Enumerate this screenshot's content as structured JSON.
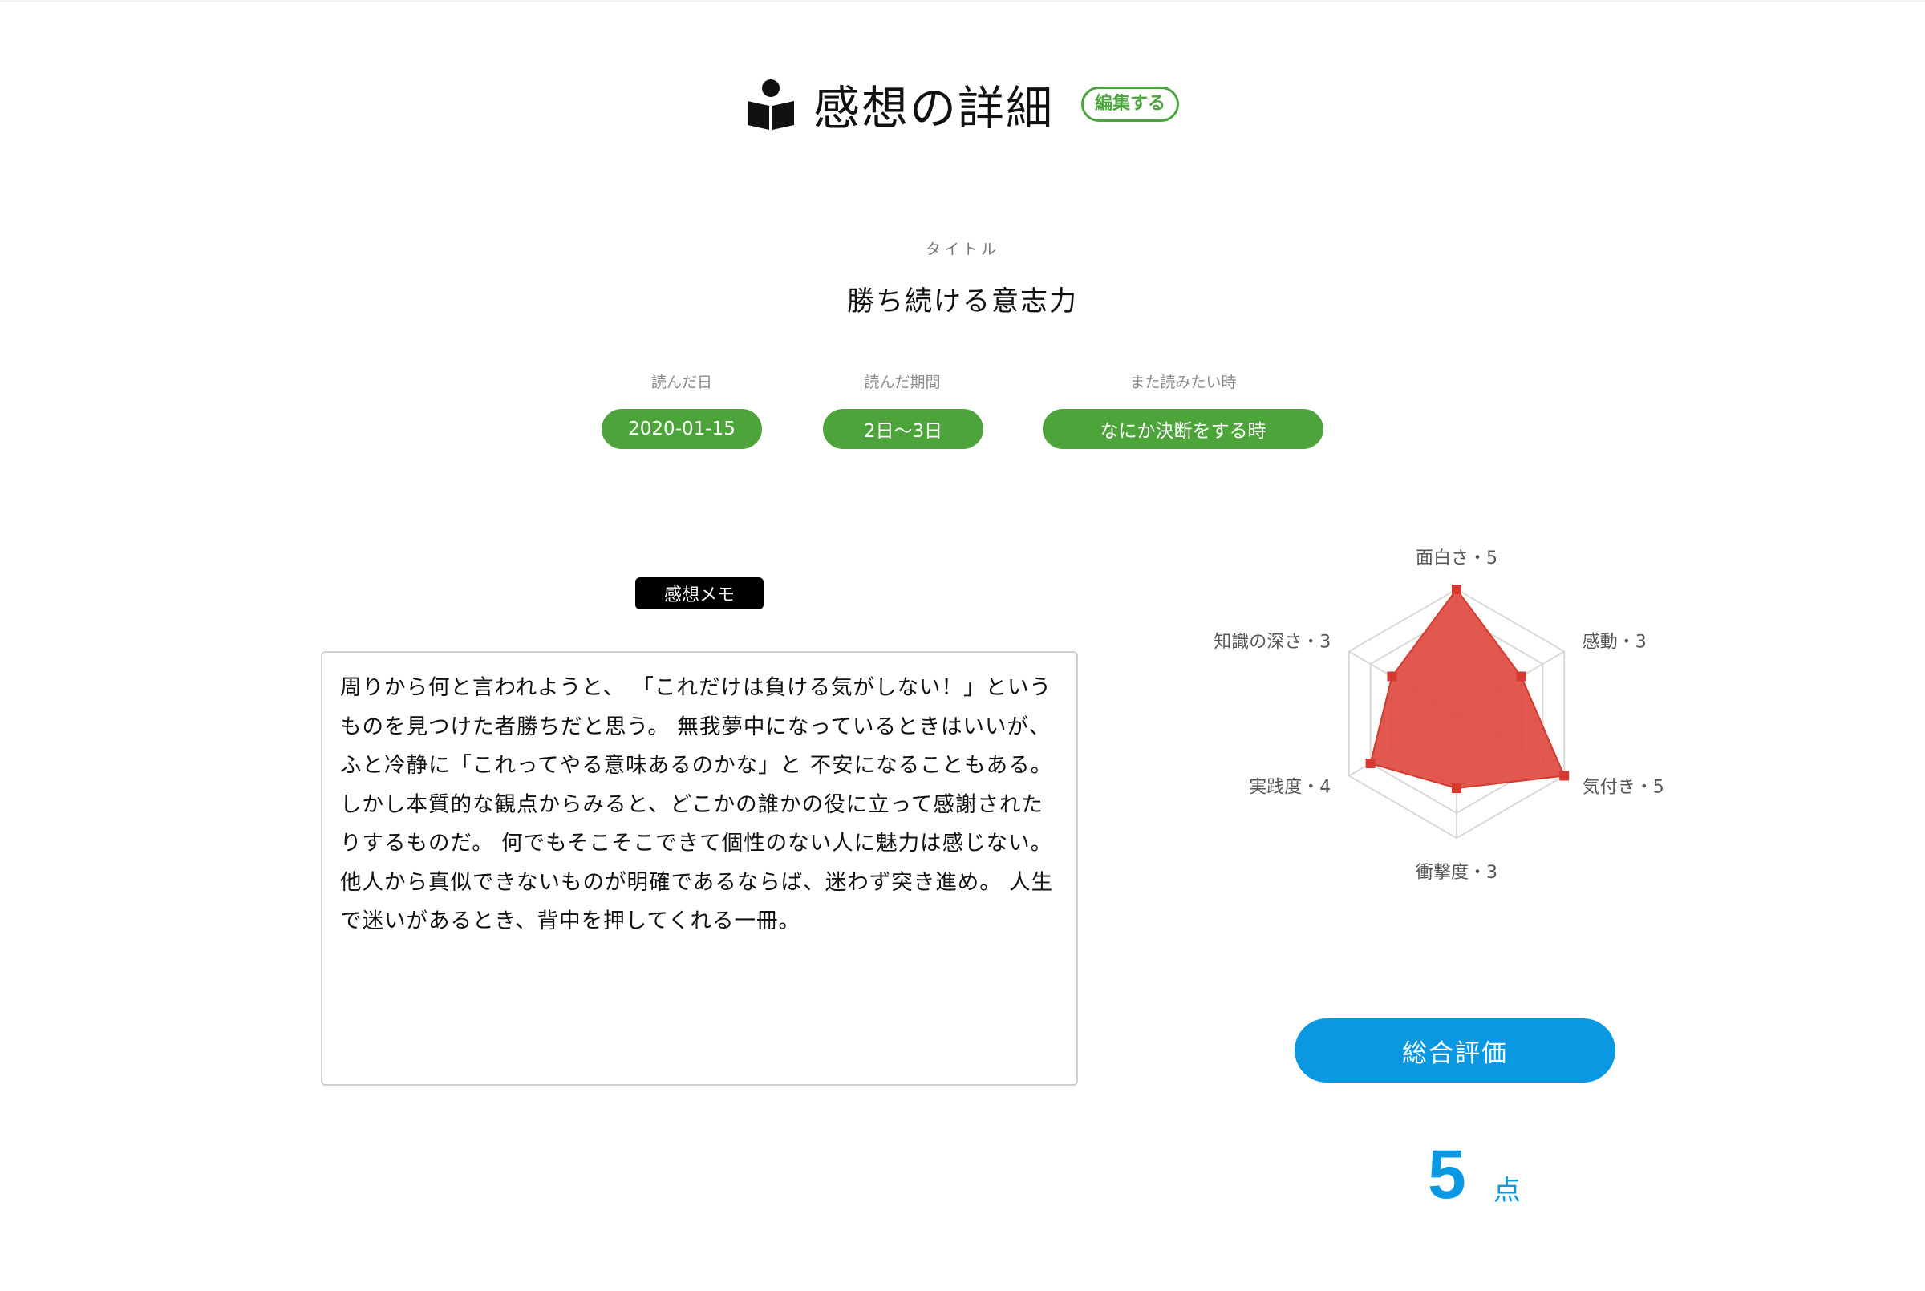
{
  "header": {
    "title": "感想の詳細",
    "edit_label": "編集する",
    "icon": "book-reader-icon"
  },
  "book": {
    "title_label": "タイトル",
    "title": "勝ち続ける意志力"
  },
  "meta": {
    "read_date_label": "読んだ日",
    "read_date": "2020-01-15",
    "read_period_label": "読んだ期間",
    "read_period": "2日〜3日",
    "reread_label": "また読みたい時",
    "reread_when": "なにか決断をする時"
  },
  "memo": {
    "tag": "感想メモ",
    "text": "周りから何と言われようと、 「これだけは負ける気がしない！」というものを見つけた者勝ちだと思う。 無我夢中になっているときはいいが、ふと冷静に「これってやる意味あるのかな」と 不安になることもある。 しかし本質的な観点からみると、どこかの誰かの役に立って感謝されたりするものだ。 何でもそこそこできて個性のない人に魅力は感じない。 他人から真似できないものが明確であるならば、迷わず突き進め。 人生で迷いがあるとき、背中を押してくれる一冊。"
  },
  "chart_data": {
    "type": "radar",
    "axes": [
      {
        "name": "面白さ",
        "value": 5,
        "label": "面白さ・5"
      },
      {
        "name": "感動",
        "value": 3,
        "label": "感動・3"
      },
      {
        "name": "気付き",
        "value": 5,
        "label": "気付き・5"
      },
      {
        "name": "衝撃度",
        "value": 3,
        "label": "衝撃度・3"
      },
      {
        "name": "実践度",
        "value": 4,
        "label": "実践度・4"
      },
      {
        "name": "知識の深さ",
        "value": 3,
        "label": "知識の深さ・3"
      }
    ],
    "max": 5,
    "levels": 5,
    "colors": {
      "fill": "#dd4a3f",
      "stroke": "#d43a2f",
      "grid": "#d9d9d9"
    }
  },
  "overall": {
    "label": "総合評価",
    "score": "5",
    "unit": "点"
  },
  "colors": {
    "green": "#4ca43a",
    "blue": "#0a98e3",
    "red": "#dd4a3f"
  }
}
